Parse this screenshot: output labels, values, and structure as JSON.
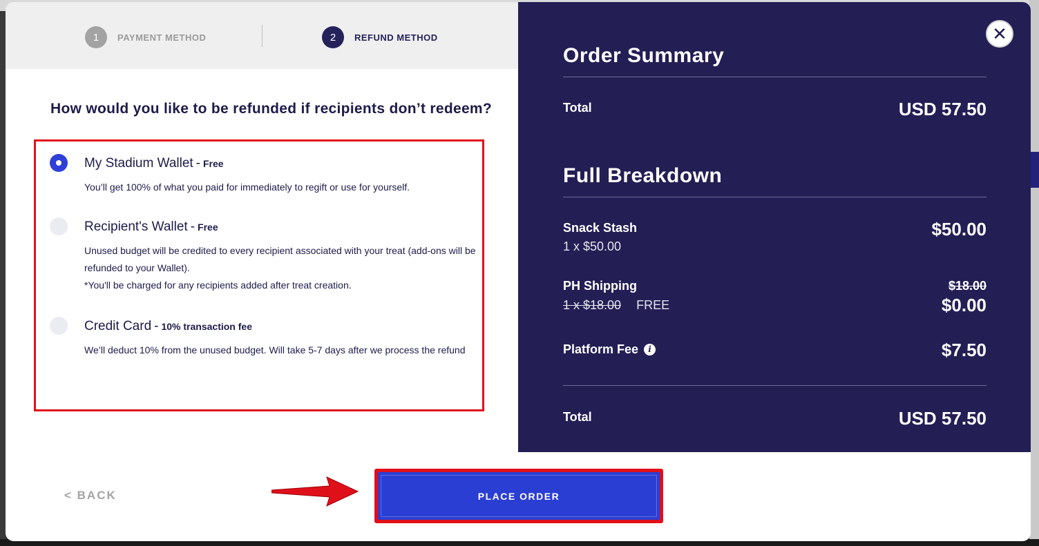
{
  "stepper": {
    "steps": [
      {
        "number": "1",
        "label": "PAYMENT METHOD"
      },
      {
        "number": "2",
        "label": "REFUND METHOD"
      }
    ]
  },
  "refund": {
    "question": "How would you like to be refunded if recipients don’t redeem?",
    "options": [
      {
        "title": "My Stadium Wallet",
        "tag": "Free",
        "selected": true,
        "description": "You’ll get 100% of what you paid for immediately to regift or use for yourself."
      },
      {
        "title": "Recipient's Wallet",
        "tag": "Free",
        "selected": false,
        "description": "Unused budget will be credited to every recipient associated with your treat (add-ons will be refunded to your Wallet).",
        "note": "*You'll be charged for any recipients added after treat creation."
      },
      {
        "title": "Credit Card",
        "tag": "10% transaction fee",
        "selected": false,
        "description": "We’ll deduct 10% from the unused budget. Will take 5-7 days after we process the refund"
      }
    ]
  },
  "summary": {
    "title": "Order Summary",
    "total_label": "Total",
    "total_value": "USD 57.50",
    "breakdown_title": "Full Breakdown",
    "items": [
      {
        "name": "Snack Stash",
        "sub": "1 x $50.00",
        "value": "$50.00"
      },
      {
        "name": "PH Shipping",
        "sub_strike": "1 x $18.00",
        "sub_free": "FREE",
        "value_strike": "$18.00",
        "value": "$0.00"
      },
      {
        "name": "Platform Fee",
        "value": "$7.50",
        "icon": "info-icon"
      }
    ],
    "bottom_total_label": "Total",
    "bottom_total_value": "USD 57.50"
  },
  "actions": {
    "back_label": "< BACK",
    "place_order_label": "PLACE ORDER",
    "close_icon": "close-icon"
  },
  "colors": {
    "accent": "#2b3ed3",
    "navy": "#231e54",
    "highlight": "#e0101a"
  }
}
